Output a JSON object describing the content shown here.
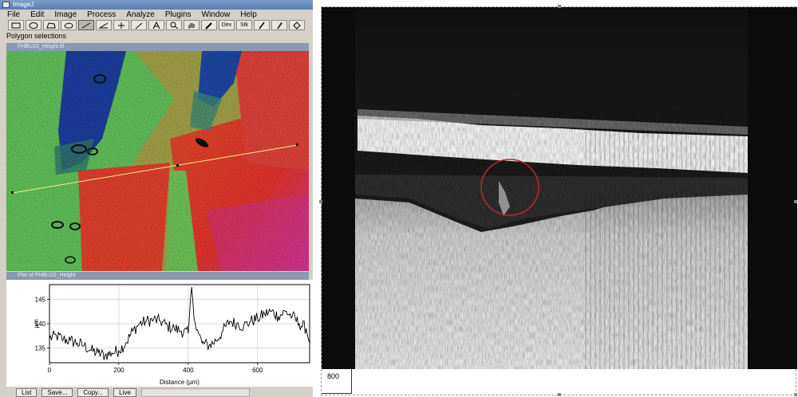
{
  "app": {
    "title": "ImageJ",
    "menu": [
      "File",
      "Edit",
      "Image",
      "Process",
      "Analyze",
      "Plugins",
      "Window",
      "Help"
    ],
    "tool_icons": [
      "rectangle-tool-icon",
      "oval-tool-icon",
      "polygon-tool-icon",
      "freehand-tool-icon",
      "straight-line-tool-icon",
      "angle-tool-icon",
      "point-tool-icon",
      "wand-tool-icon",
      "text-tool-icon",
      "magnifier-tool-icon",
      "hand-tool-icon",
      "color-picker-tool-icon",
      "dev-tool-icon",
      "stk-tool-icon",
      "pencil-tool-icon",
      "brush-tool-icon",
      "flood-fill-tool-icon"
    ],
    "dev_label": "Dev",
    "stk_label": "Stk",
    "status": "Polygon selections"
  },
  "image_window": {
    "title": "FHBU10_Height.tif",
    "colors": {
      "green": "#62c25a",
      "blue": "#1a3f9c",
      "red": "#e23a2e",
      "magenta": "#cc2a86"
    }
  },
  "plot_window": {
    "title": "Plot of FHBU10_Height",
    "xlabel": "Distance (µm)",
    "ylabel": "µm",
    "buttons": [
      "List",
      "Save...",
      "Copy...",
      "Live"
    ]
  },
  "chart_data": {
    "type": "line",
    "title": "",
    "xlabel": "Distance (µm)",
    "ylabel": "µm",
    "xlim": [
      0,
      750
    ],
    "ylim": [
      132,
      148
    ],
    "xticks": [
      0,
      200,
      400,
      600
    ],
    "yticks": [
      135,
      140,
      145
    ],
    "grid": true,
    "series": [
      {
        "name": "",
        "x": [
          0,
          20,
          40,
          60,
          80,
          100,
          120,
          140,
          160,
          180,
          200,
          220,
          240,
          260,
          280,
          300,
          320,
          340,
          360,
          380,
          400,
          410,
          420,
          430,
          440,
          460,
          480,
          500,
          520,
          540,
          560,
          580,
          600,
          620,
          640,
          660,
          680,
          700,
          720,
          740,
          750
        ],
        "y": [
          137.0,
          137.5,
          136.8,
          136.5,
          136.0,
          135.5,
          134.5,
          134.0,
          133.5,
          134.0,
          134.5,
          136.0,
          138.5,
          140.0,
          140.5,
          140.8,
          140.5,
          139.5,
          139.0,
          138.5,
          138.0,
          147.5,
          140.0,
          138.0,
          136.0,
          135.5,
          136.5,
          138.5,
          140.5,
          140.0,
          139.5,
          140.5,
          141.0,
          142.0,
          142.5,
          141.5,
          142.5,
          141.5,
          140.0,
          139.0,
          136.0
        ]
      }
    ]
  },
  "stack_view": {
    "scale_label": "800",
    "colors": {
      "dark": "#141414",
      "bright": "#f2f2f2",
      "roi_circle": "#c0262a"
    }
  }
}
